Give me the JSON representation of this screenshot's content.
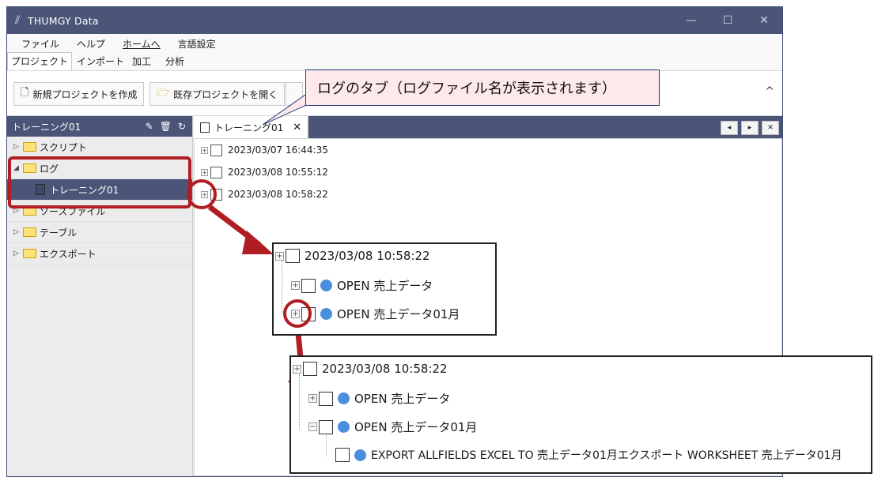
{
  "app": {
    "title": "THUMGY Data",
    "icon": "thumgy-logo-icon"
  },
  "window_controls": [
    "—",
    "☐",
    "✕"
  ],
  "menu": [
    "ファイル",
    "ヘルプ",
    "ホームへ",
    "言語設定"
  ],
  "ribbon_tabs": [
    "プロジェクト",
    "インポート",
    "加工",
    "分析"
  ],
  "ribbon": {
    "new_project": "新規プロジェクトを作成",
    "open_project": "既存プロジェクトを開く",
    "collapse": "^"
  },
  "sidebar": {
    "header": "トレーニング01",
    "items": [
      {
        "label": "スクリプト"
      },
      {
        "label": "ログ"
      },
      {
        "label": "トレーニング01"
      },
      {
        "label": "ソースファイル"
      },
      {
        "label": "テーブル"
      },
      {
        "label": "エクスポート"
      }
    ]
  },
  "doc_tab": {
    "label": "トレーニング01",
    "close": "✕"
  },
  "nav": [
    "◂",
    "▸",
    "✕"
  ],
  "log_entries": [
    "2023/03/07 16:44:35",
    "2023/03/08 10:55:12",
    "2023/03/08 10:58:22"
  ],
  "callout": {
    "text": "ログのタブ（ログファイル名が表示されます）"
  },
  "zoom1": {
    "root": "2023/03/08 10:58:22",
    "rows": [
      "OPEN 売上データ",
      "OPEN 売上データ01月"
    ]
  },
  "zoom2": {
    "root": "2023/03/08 10:58:22",
    "rows": [
      "OPEN 売上データ",
      "OPEN 売上データ01月"
    ],
    "child": "EXPORT ALLFIELDS EXCEL TO 売上データ01月エクスポート WORKSHEET 売上データ01月"
  },
  "colors": {
    "titlebar": "#4a5577",
    "highlight": "#b01e24",
    "dot": "#4a8ede"
  }
}
